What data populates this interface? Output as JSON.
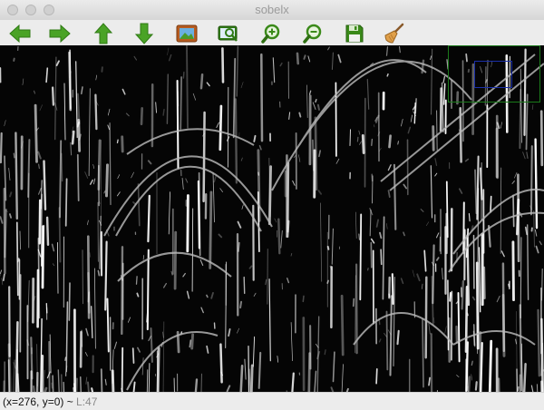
{
  "window": {
    "title": "sobelx"
  },
  "toolbar": {
    "buttons": [
      {
        "name": "back-button",
        "icon": "arrow-left-icon"
      },
      {
        "name": "forward-button",
        "icon": "arrow-right-icon"
      },
      {
        "name": "up-button",
        "icon": "arrow-up-icon"
      },
      {
        "name": "down-button",
        "icon": "arrow-down-icon"
      },
      {
        "name": "fit-image-button",
        "icon": "picture-icon"
      },
      {
        "name": "zoom-original-button",
        "icon": "zoom-image-icon"
      },
      {
        "name": "zoom-in-button",
        "icon": "zoom-in-icon"
      },
      {
        "name": "zoom-out-button",
        "icon": "zoom-out-icon"
      },
      {
        "name": "save-button",
        "icon": "floppy-disk-icon"
      },
      {
        "name": "properties-button",
        "icon": "broom-icon"
      }
    ],
    "accent_color": "#3f9a1f"
  },
  "image": {
    "description_icon": "sobel-edge-image",
    "background_color": "#050505",
    "edge_color": "#ffffff"
  },
  "status": {
    "coords": "(x=276, y=0) ~ ",
    "value": "L:47"
  }
}
